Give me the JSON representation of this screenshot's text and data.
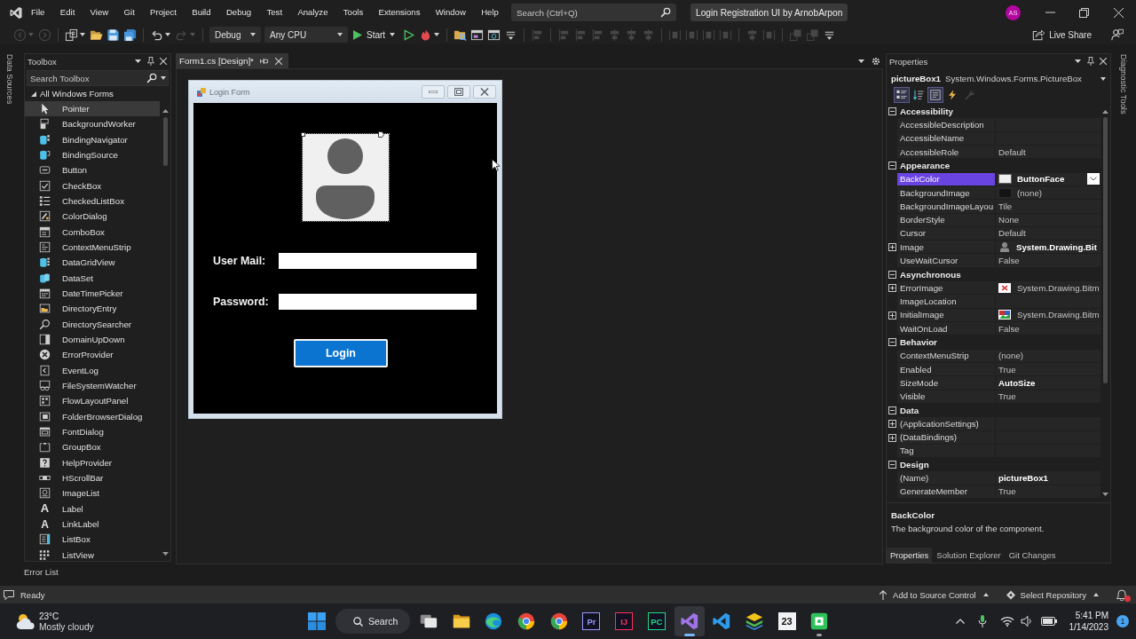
{
  "menu_bar": {
    "items": [
      "File",
      "Edit",
      "View",
      "Git",
      "Project",
      "Build",
      "Debug",
      "Test",
      "Analyze",
      "Tools",
      "Extensions",
      "Window",
      "Help"
    ],
    "search": {
      "placeholder": "Search (Ctrl+Q)"
    },
    "solution_name": "Login Registration UI by ArnobArpon",
    "avatar": "AS"
  },
  "toolbar": {
    "groups": [
      [
        {
          "kind": "back",
          "disabled": true,
          "caret": true
        },
        {
          "kind": "forward",
          "disabled": true,
          "caret": false
        }
      ],
      [
        {
          "kind": "new-item",
          "disabled": false,
          "caret": true
        },
        {
          "kind": "open",
          "disabled": false,
          "caret": false
        },
        {
          "kind": "save",
          "disabled": false,
          "caret": false
        },
        {
          "kind": "save-all",
          "disabled": false,
          "caret": false
        }
      ],
      [
        {
          "kind": "undo",
          "disabled": false,
          "caret": true
        },
        {
          "kind": "redo",
          "disabled": true,
          "caret": true
        }
      ],
      [
        {
          "kind": "dropdown",
          "value": "Debug",
          "disabled": false,
          "caret": true
        },
        {
          "kind": "dropdown",
          "value": "Any CPU",
          "disabled": false,
          "caret": true
        },
        {
          "kind": "start",
          "value": "Start",
          "disabled": false,
          "caret": true
        },
        {
          "kind": "run",
          "disabled": false,
          "caret": false
        },
        {
          "kind": "hot-reload",
          "disabled": false,
          "caret": true
        }
      ],
      [
        {
          "kind": "find",
          "disabled": false,
          "caret": false
        },
        {
          "kind": "window",
          "disabled": false,
          "caret": false
        },
        {
          "kind": "browser",
          "disabled": false,
          "caret": false
        },
        {
          "kind": "overflow",
          "disabled": false,
          "caret": false
        }
      ],
      [
        {
          "kind": "align",
          "disabled": true,
          "caret": false
        }
      ],
      [
        {
          "kind": "align",
          "disabled": true,
          "caret": false
        },
        {
          "kind": "align",
          "disabled": true,
          "caret": false
        },
        {
          "kind": "align",
          "disabled": true,
          "caret": false
        },
        {
          "kind": "center",
          "disabled": true,
          "caret": false
        },
        {
          "kind": "center",
          "disabled": true,
          "caret": false
        },
        {
          "kind": "center",
          "disabled": true,
          "caret": false
        }
      ],
      [
        {
          "kind": "spacing",
          "disabled": true,
          "caret": false
        },
        {
          "kind": "spacing",
          "disabled": true,
          "caret": false
        },
        {
          "kind": "spacing",
          "disabled": true,
          "caret": false
        },
        {
          "kind": "spacing",
          "disabled": true,
          "caret": false
        }
      ],
      [
        {
          "kind": "center",
          "disabled": true,
          "caret": false
        },
        {
          "kind": "spacing",
          "disabled": true,
          "caret": false
        }
      ],
      [
        {
          "kind": "order",
          "disabled": true,
          "caret": false
        },
        {
          "kind": "order",
          "disabled": true,
          "caret": false
        },
        {
          "kind": "overflow",
          "disabled": false,
          "caret": false
        }
      ]
    ],
    "live_share": "Live Share"
  },
  "side_tabs": {
    "left": "Data Sources",
    "right": "Diagnostic Tools"
  },
  "toolbox": {
    "title": "Toolbox",
    "search": {
      "placeholder": "Search Toolbox"
    },
    "group": {
      "label": "All Windows Forms",
      "expanded": true
    },
    "items": [
      {
        "label": "Pointer",
        "selected": true
      },
      {
        "label": "BackgroundWorker",
        "selected": false
      },
      {
        "label": "BindingNavigator",
        "selected": false
      },
      {
        "label": "BindingSource",
        "selected": false
      },
      {
        "label": "Button",
        "selected": false
      },
      {
        "label": "CheckBox",
        "selected": false
      },
      {
        "label": "CheckedListBox",
        "selected": false
      },
      {
        "label": "ColorDialog",
        "selected": false
      },
      {
        "label": "ComboBox",
        "selected": false
      },
      {
        "label": "ContextMenuStrip",
        "selected": false
      },
      {
        "label": "DataGridView",
        "selected": false
      },
      {
        "label": "DataSet",
        "selected": false
      },
      {
        "label": "DateTimePicker",
        "selected": false
      },
      {
        "label": "DirectoryEntry",
        "selected": false
      },
      {
        "label": "DirectorySearcher",
        "selected": false
      },
      {
        "label": "DomainUpDown",
        "selected": false
      },
      {
        "label": "ErrorProvider",
        "selected": false
      },
      {
        "label": "EventLog",
        "selected": false
      },
      {
        "label": "FileSystemWatcher",
        "selected": false
      },
      {
        "label": "FlowLayoutPanel",
        "selected": false
      },
      {
        "label": "FolderBrowserDialog",
        "selected": false
      },
      {
        "label": "FontDialog",
        "selected": false
      },
      {
        "label": "GroupBox",
        "selected": false
      },
      {
        "label": "HelpProvider",
        "selected": false
      },
      {
        "label": "HScrollBar",
        "selected": false
      },
      {
        "label": "ImageList",
        "selected": false
      },
      {
        "label": "Label",
        "glyph": "A",
        "selected": false
      },
      {
        "label": "LinkLabel",
        "glyph": "A",
        "selected": false
      },
      {
        "label": "ListBox",
        "selected": false
      },
      {
        "label": "ListView",
        "selected": false
      }
    ],
    "footer_tab": "Error List"
  },
  "document": {
    "tabs": [
      {
        "label": "Form1.cs [Design]*",
        "selected": true
      }
    ],
    "form": {
      "title": "Login Form",
      "picture_box": {
        "selected": true
      },
      "fields": [
        {
          "label": "User Mail:"
        },
        {
          "label": "Password:"
        }
      ],
      "button": "Login"
    }
  },
  "properties": {
    "title": "Properties",
    "object": {
      "name": "pictureBox1",
      "type": "System.Windows.Forms.PictureBox"
    },
    "view_buttons": [
      {
        "kind": "categorized",
        "selected": true,
        "disabled": false
      },
      {
        "kind": "alphabetical",
        "selected": false,
        "disabled": false
      },
      {
        "kind": "properties",
        "selected": true,
        "disabled": false
      },
      {
        "kind": "events",
        "selected": false,
        "disabled": false
      },
      {
        "kind": "pages",
        "selected": false,
        "disabled": true
      }
    ],
    "categories": [
      {
        "name": "Accessibility",
        "expanded": true,
        "rows": [
          {
            "name": "AccessibleDescription",
            "kind": "plain",
            "expandable": false,
            "selected": false
          },
          {
            "name": "AccessibleName",
            "kind": "plain",
            "expandable": false,
            "selected": false
          },
          {
            "name": "AccessibleRole",
            "value": "Default",
            "kind": "plain",
            "expandable": false,
            "modified": false,
            "selected": false
          }
        ]
      },
      {
        "name": "Appearance",
        "expanded": true,
        "rows": [
          {
            "name": "BackColor",
            "value": "ButtonFace",
            "kind": "color",
            "color": "#f0f0f0",
            "expandable": false,
            "modified": true,
            "selected": true
          },
          {
            "name": "BackgroundImage",
            "value": "(none)",
            "kind": "empty-image",
            "expandable": false,
            "modified": false,
            "selected": false
          },
          {
            "name": "BackgroundImageLayou",
            "value": "Tile",
            "kind": "plain",
            "expandable": false,
            "modified": false,
            "selected": false
          },
          {
            "name": "BorderStyle",
            "value": "None",
            "kind": "plain",
            "expandable": false,
            "modified": false,
            "selected": false
          },
          {
            "name": "Cursor",
            "value": "Default",
            "kind": "plain",
            "expandable": false,
            "modified": false,
            "selected": false
          },
          {
            "name": "Image",
            "value": "System.Drawing.Bit",
            "kind": "avatar-image",
            "expandable": true,
            "modified": true,
            "selected": false
          },
          {
            "name": "UseWaitCursor",
            "value": "False",
            "kind": "plain",
            "expandable": false,
            "modified": false,
            "selected": false
          }
        ]
      },
      {
        "name": "Asynchronous",
        "expanded": true,
        "rows": [
          {
            "name": "ErrorImage",
            "value": "System.Drawing.Bitm",
            "kind": "error-image",
            "expandable": true,
            "modified": false,
            "selected": false
          },
          {
            "name": "ImageLocation",
            "kind": "plain",
            "expandable": false,
            "selected": false
          },
          {
            "name": "InitialImage",
            "value": "System.Drawing.Bitm",
            "kind": "picture-image",
            "expandable": true,
            "modified": false,
            "selected": false
          },
          {
            "name": "WaitOnLoad",
            "value": "False",
            "kind": "plain",
            "expandable": false,
            "modified": false,
            "selected": false
          }
        ]
      },
      {
        "name": "Behavior",
        "expanded": true,
        "rows": [
          {
            "name": "ContextMenuStrip",
            "value": "(none)",
            "kind": "plain",
            "expandable": false,
            "modified": false,
            "selected": false
          },
          {
            "name": "Enabled",
            "value": "True",
            "kind": "plain",
            "expandable": false,
            "modified": false,
            "selected": false
          },
          {
            "name": "SizeMode",
            "value": "AutoSize",
            "kind": "plain",
            "expandable": false,
            "modified": true,
            "selected": false
          },
          {
            "name": "Visible",
            "value": "True",
            "kind": "plain",
            "expandable": false,
            "modified": false,
            "selected": false
          }
        ]
      },
      {
        "name": "Data",
        "expanded": true,
        "rows": [
          {
            "name": "(ApplicationSettings)",
            "kind": "plain",
            "expandable": true,
            "selected": false
          },
          {
            "name": "(DataBindings)",
            "kind": "plain",
            "expandable": true,
            "selected": false
          },
          {
            "name": "Tag",
            "kind": "plain",
            "expandable": false,
            "selected": false
          }
        ]
      },
      {
        "name": "Design",
        "expanded": true,
        "rows": [
          {
            "name": "(Name)",
            "value": "pictureBox1",
            "kind": "plain",
            "expandable": false,
            "modified": true,
            "selected": false
          },
          {
            "name": "GenerateMember",
            "value": "True",
            "kind": "plain",
            "expandable": false,
            "modified": false,
            "selected": false
          }
        ]
      }
    ],
    "description": {
      "title": "BackColor",
      "text": "The background color of the component."
    },
    "tabs": [
      {
        "label": "Properties",
        "selected": true
      },
      {
        "label": "Solution Explorer",
        "selected": false
      },
      {
        "label": "Git Changes",
        "selected": false
      }
    ]
  },
  "status_bar": {
    "text": "Ready",
    "buttons": [
      {
        "kind": "upload",
        "label": "Add to Source Control"
      },
      {
        "kind": "repository",
        "label": "Select Repository"
      }
    ],
    "unread": true
  },
  "taskbar": {
    "weather": {
      "temperature": "23°C",
      "condition": "Mostly cloudy"
    },
    "search": "Search",
    "apps": [
      {
        "kind": "overlap",
        "running": false,
        "selected": false
      },
      {
        "kind": "folder",
        "running": false,
        "selected": false
      },
      {
        "kind": "swirl",
        "running": false,
        "selected": false
      },
      {
        "kind": "ring",
        "running": false,
        "selected": false
      },
      {
        "kind": "ring",
        "running": false,
        "selected": false
      },
      {
        "kind": "tile-dark",
        "glyph": "Pr",
        "color": "#9999ff",
        "running": false,
        "selected": false
      },
      {
        "kind": "tile-dark",
        "glyph": "IJ",
        "color": "#fe315d",
        "running": false,
        "selected": false
      },
      {
        "kind": "tile-dark",
        "glyph": "PC",
        "color": "#21d789",
        "running": false,
        "selected": false
      },
      {
        "kind": "ribbon",
        "color": "#a074e4",
        "running": true,
        "selected": true
      },
      {
        "kind": "ribbon",
        "color": "#2f9be8",
        "running": false,
        "selected": false
      },
      {
        "kind": "layers",
        "running": false,
        "selected": false
      },
      {
        "kind": "tile-light",
        "glyph": "23",
        "color": "#f2f2f2",
        "running": false,
        "selected": false
      },
      {
        "kind": "square-tile",
        "running": true,
        "selected": false
      }
    ],
    "clock": {
      "time": "5:41 PM",
      "date": "1/14/2023"
    },
    "notification_count": "1"
  }
}
